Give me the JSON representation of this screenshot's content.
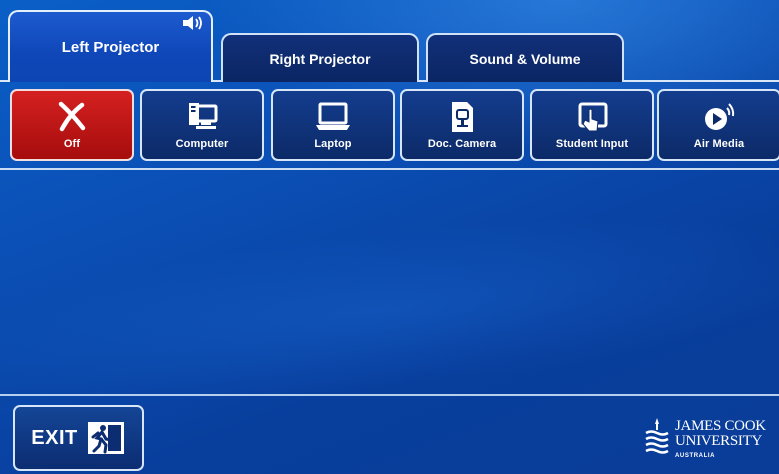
{
  "tabs": [
    {
      "label": "Left Projector",
      "active": true,
      "badge_icon": "speaker-icon"
    },
    {
      "label": "Right Projector",
      "active": false
    },
    {
      "label": "Sound & Volume",
      "active": false
    }
  ],
  "sources": [
    {
      "label": "Off",
      "icon": "power-off-x-icon",
      "color": "#c81818"
    },
    {
      "label": "Computer",
      "icon": "computer-icon"
    },
    {
      "label": "Laptop",
      "icon": "laptop-icon"
    },
    {
      "label": "Doc. Camera",
      "icon": "document-camera-icon"
    },
    {
      "label": "Student Input",
      "icon": "tablet-touch-icon"
    },
    {
      "label": "Air Media",
      "icon": "air-media-icon"
    }
  ],
  "exit": {
    "label": "EXIT",
    "icon": "emergency-exit-icon"
  },
  "logo": {
    "line1": "JAMES COOK",
    "line2": "UNIVERSITY",
    "line3": "AUSTRALIA"
  },
  "colors": {
    "background": "#0b4fb5",
    "button": "#0c2a68",
    "off_button": "#c81818",
    "border": "#d6e6f8"
  }
}
